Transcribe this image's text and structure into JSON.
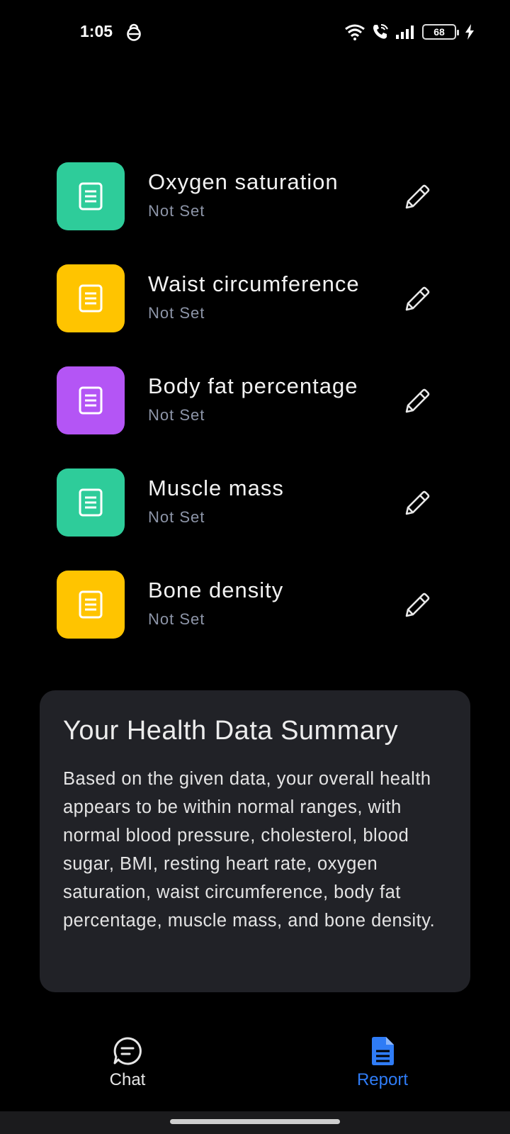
{
  "status_bar": {
    "time": "1:05",
    "battery": "68"
  },
  "metrics": [
    {
      "title": "Oxygen saturation",
      "value": "Not Set",
      "color": "#2ecc9a"
    },
    {
      "title": "Waist circumference",
      "value": "Not Set",
      "color": "#ffc400"
    },
    {
      "title": "Body fat percentage",
      "value": "Not Set",
      "color": "#b455f5"
    },
    {
      "title": "Muscle mass",
      "value": "Not Set",
      "color": "#2ecc9a"
    },
    {
      "title": "Bone density",
      "value": "Not Set",
      "color": "#ffc400"
    }
  ],
  "summary": {
    "title": "Your Health Data Summary",
    "body": "Based on the given data, your overall health appears to be within normal ranges, with normal blood pressure, cholesterol, blood sugar, BMI, resting heart rate, oxygen saturation, waist circumference, body fat percentage, muscle mass, and bone density."
  },
  "nav": {
    "chat_label": "Chat",
    "report_label": "Report",
    "active": "report",
    "active_color": "#2f7cf6"
  }
}
